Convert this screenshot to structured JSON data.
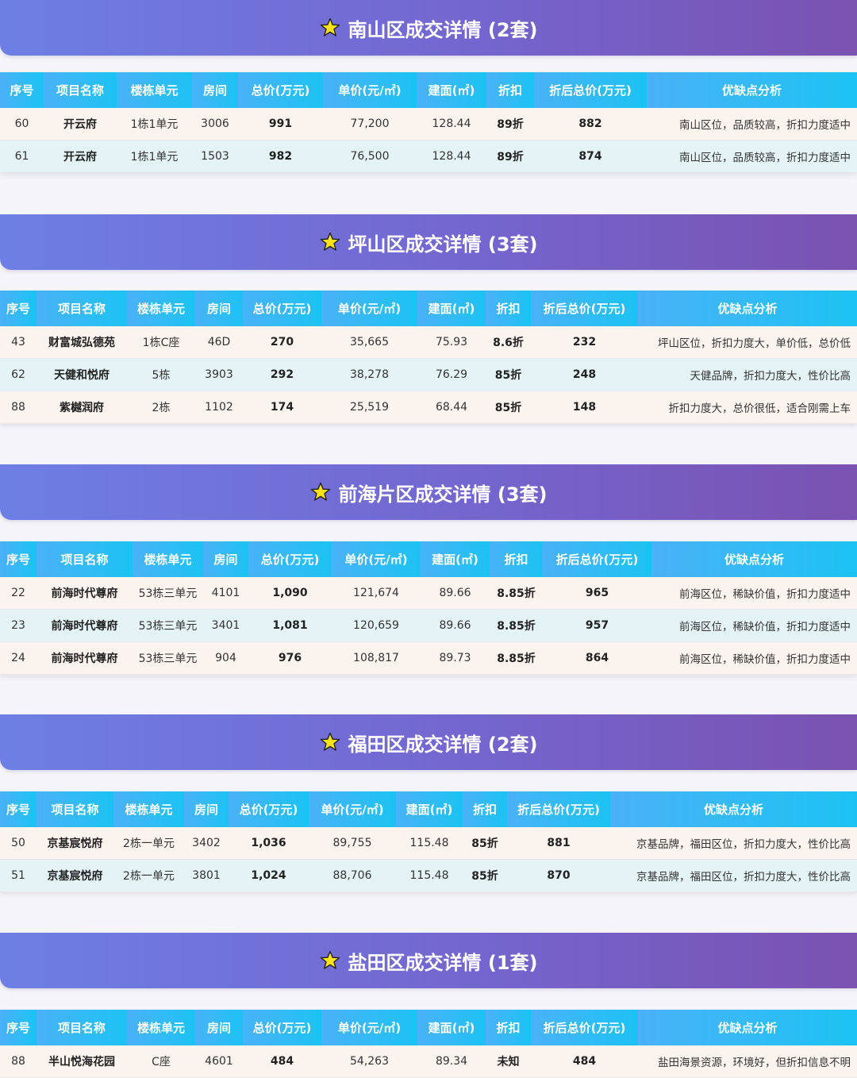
{
  "headers": [
    "序号",
    "项目名称",
    "楼栋单元",
    "房间",
    "总价(万元)",
    "单价(元/㎡)",
    "建面(㎡)",
    "折扣",
    "折后总价(万元)",
    "优缺点分析"
  ],
  "icons": {
    "banner": "star-icon"
  },
  "colors": {
    "banner_start": "#6d7fe4",
    "banner_end": "#7a52b0",
    "header_start": "#4ab2f6",
    "header_end": "#1cc3f2",
    "row_odd": "#fbf4ee",
    "row_even": "#e4f3f5"
  },
  "sections": [
    {
      "title": "南山区成交详情 (2套)",
      "rows": [
        [
          "60",
          "开云府",
          "1栋1单元",
          "3006",
          "991",
          "77,200",
          "128.44",
          "89折",
          "882",
          "南山区位，品质较高，折扣力度适中"
        ],
        [
          "61",
          "开云府",
          "1栋1单元",
          "1503",
          "982",
          "76,500",
          "128.44",
          "89折",
          "874",
          "南山区位，品质较高，折扣力度适中"
        ]
      ]
    },
    {
      "title": "坪山区成交详情 (3套)",
      "rows": [
        [
          "43",
          "财富城弘德苑",
          "1栋C座",
          "46D",
          "270",
          "35,665",
          "75.93",
          "8.6折",
          "232",
          "坪山区位，折扣力度大，单价低，总价低"
        ],
        [
          "62",
          "天健和悦府",
          "5栋",
          "3903",
          "292",
          "38,278",
          "76.29",
          "85折",
          "248",
          "天健品牌，折扣力度大，性价比高"
        ],
        [
          "88",
          "紫樾润府",
          "2栋",
          "1102",
          "174",
          "25,519",
          "68.44",
          "85折",
          "148",
          "折扣力度大，总价很低，适合刚需上车"
        ]
      ]
    },
    {
      "title": "前海片区成交详情 (3套)",
      "rows": [
        [
          "22",
          "前海时代尊府",
          "53栋三单元",
          "4101",
          "1,090",
          "121,674",
          "89.66",
          "8.85折",
          "965",
          "前海区位，稀缺价值，折扣力度适中"
        ],
        [
          "23",
          "前海时代尊府",
          "53栋三单元",
          "3401",
          "1,081",
          "120,659",
          "89.66",
          "8.85折",
          "957",
          "前海区位，稀缺价值，折扣力度适中"
        ],
        [
          "24",
          "前海时代尊府",
          "53栋三单元",
          "904",
          "976",
          "108,817",
          "89.73",
          "8.85折",
          "864",
          "前海区位，稀缺价值，折扣力度适中"
        ]
      ]
    },
    {
      "title": "福田区成交详情 (2套)",
      "rows": [
        [
          "50",
          "京基宸悦府",
          "2栋一单元",
          "3402",
          "1,036",
          "89,755",
          "115.48",
          "85折",
          "881",
          "京基品牌，福田区位，折扣力度大，性价比高"
        ],
        [
          "51",
          "京基宸悦府",
          "2栋一单元",
          "3801",
          "1,024",
          "88,706",
          "115.48",
          "85折",
          "870",
          "京基品牌，福田区位，折扣力度大，性价比高"
        ]
      ]
    },
    {
      "title": "盐田区成交详情 (1套)",
      "rows": [
        [
          "88",
          "半山悦海花园",
          "C座",
          "4601",
          "484",
          "54,263",
          "89.34",
          "未知",
          "484",
          "盐田海景资源，环境好，但折扣信息不明"
        ]
      ]
    }
  ]
}
